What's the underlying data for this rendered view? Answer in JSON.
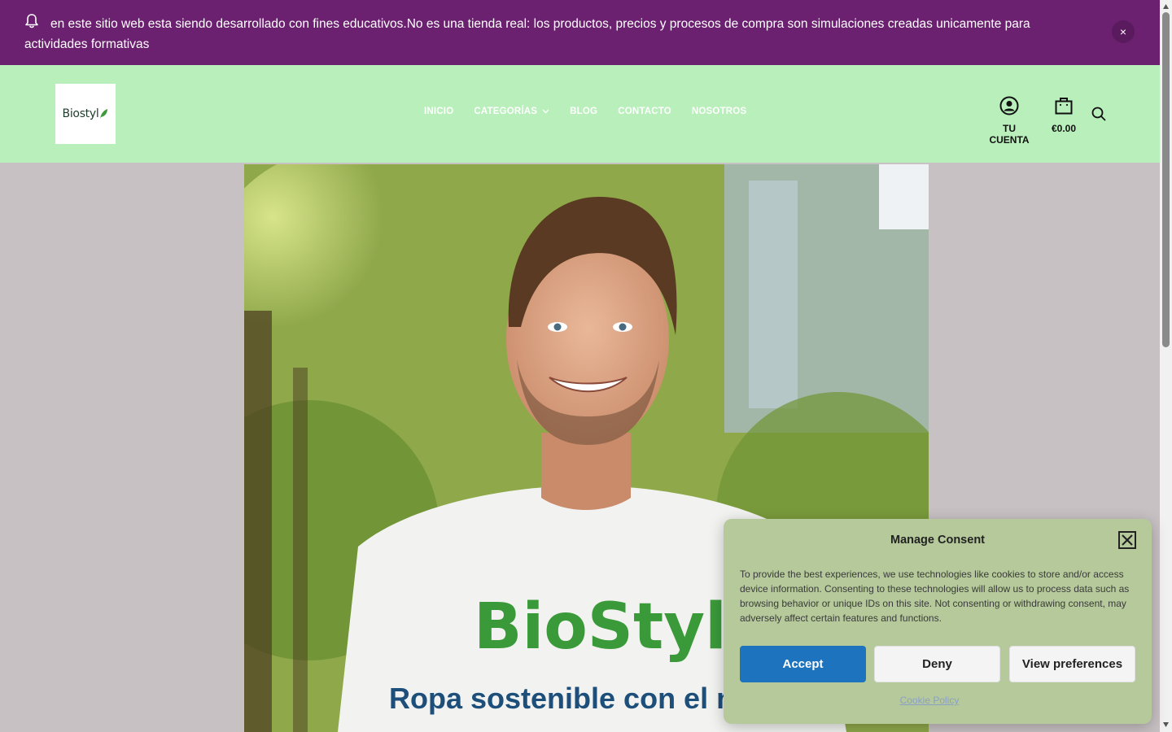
{
  "notice": {
    "text": "en este sitio web esta siendo desarrollado con fines educativos.No es una tienda real: los productos, precios y procesos de compra son simulaciones creadas unicamente para actividades formativas",
    "icon": "bell-icon",
    "close_label": "×"
  },
  "header": {
    "logo_text": "Biostyl",
    "nav": [
      {
        "label": "INICIO"
      },
      {
        "label": "CATEGORÍAS"
      },
      {
        "label": "BLOG"
      },
      {
        "label": "CONTACTO"
      },
      {
        "label": "NOSOTROS"
      }
    ],
    "account_label": "TU CUENTA",
    "cart_label": "€0.00"
  },
  "hero": {
    "shirt_brand": "BioStyl",
    "title": "Ropa sostenible con el medio ambiente"
  },
  "consent": {
    "title": "Manage Consent",
    "body": "To provide the best experiences, we use technologies like cookies to store and/or access device information. Consenting to these technologies will allow us to process data such as browsing behavior or unique IDs on this site. Not consenting or withdrawing consent, may adversely affect certain features and functions.",
    "accept_label": "Accept",
    "deny_label": "Deny",
    "prefs_label": "View preferences",
    "policy_link": "Cookie Policy"
  },
  "colors": {
    "notice_bg": "#6b2070",
    "header_bg": "#b9efbb",
    "page_bg": "#c8c1c4",
    "accent": "#1e73be",
    "consent_bg": "#b5c99a"
  }
}
